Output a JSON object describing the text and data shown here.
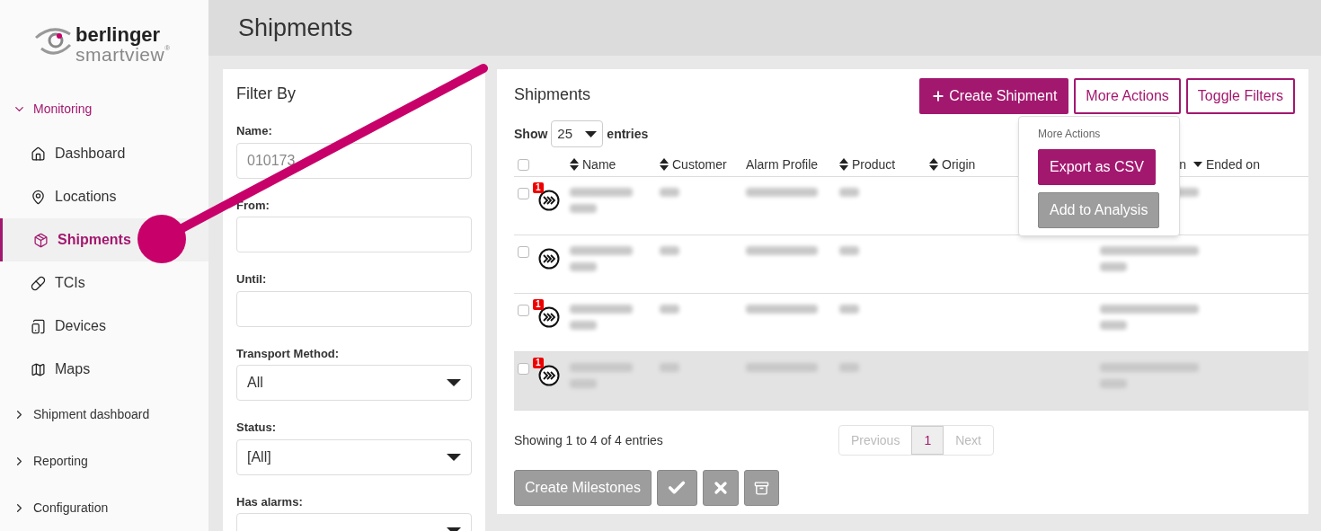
{
  "logo": {
    "line1": "berlinger",
    "line2": "smartview",
    "mark": "®"
  },
  "sidebar": {
    "groups": [
      {
        "label": "Monitoring",
        "expanded": true,
        "children": [
          {
            "label": "Dashboard",
            "kind": "home",
            "selected": false
          },
          {
            "label": "Locations",
            "kind": "pin",
            "selected": false
          },
          {
            "label": "Shipments",
            "kind": "package",
            "selected": true
          },
          {
            "label": "TCIs",
            "kind": "pill",
            "selected": false
          },
          {
            "label": "Devices",
            "kind": "device",
            "selected": false
          },
          {
            "label": "Maps",
            "kind": "map",
            "selected": false
          }
        ]
      },
      {
        "label": "Shipment dashboard",
        "expanded": false
      },
      {
        "label": "Reporting",
        "expanded": false
      },
      {
        "label": "Configuration",
        "expanded": false
      }
    ]
  },
  "page_title": "Shipments",
  "filter": {
    "title": "Filter By",
    "fields": [
      {
        "kind": "text",
        "label": "Name:",
        "placeholder": "010173"
      },
      {
        "kind": "text",
        "label": "From:"
      },
      {
        "kind": "text",
        "label": "Until:"
      },
      {
        "kind": "select",
        "label": "Transport Method:",
        "value": "All"
      },
      {
        "kind": "select",
        "label": "Status:",
        "value": "[All]"
      },
      {
        "kind": "select",
        "label": "Has alarms:"
      }
    ]
  },
  "shipments": {
    "title": "Shipments",
    "buttons": [
      {
        "kind": "primary",
        "label": "Create Shipment"
      },
      {
        "kind": "outline",
        "label": "More Actions"
      },
      {
        "kind": "outline",
        "label": "Toggle Filters"
      }
    ],
    "menu": {
      "title": "More Actions",
      "items": [
        {
          "label": "Export as CSV",
          "disabled": false
        },
        {
          "label": "Add to Analysis",
          "disabled": true
        }
      ]
    },
    "show_label": "Show",
    "page_size": "25",
    "entries_label": "entries",
    "select_all_checked": false,
    "columns": [
      {
        "label": "Name",
        "kind": "sortable"
      },
      {
        "label": "Customer",
        "kind": "sortable"
      },
      {
        "label": "Alarm Profile",
        "kind": "plain"
      },
      {
        "label": "Product",
        "kind": "sortable"
      },
      {
        "label": "Origin",
        "kind": "sortable"
      },
      {
        "label": "n",
        "kind": "plain"
      },
      {
        "label": "Ended on",
        "kind": "sorted"
      }
    ],
    "rows": [
      {
        "alarms": "1",
        "checked": false,
        "highlighted": false
      },
      {
        "checked": false,
        "highlighted": false
      },
      {
        "alarms": "1",
        "checked": false,
        "highlighted": false
      },
      {
        "alarms": "1",
        "checked": false,
        "highlighted": true
      }
    ],
    "info": "Showing 1 to 4 of 4 entries",
    "pagination": [
      {
        "label": "Previous",
        "disabled": true,
        "selected": false
      },
      {
        "label": "1",
        "disabled": false,
        "selected": true
      },
      {
        "label": "Next",
        "disabled": true,
        "selected": false
      }
    ],
    "bottom_buttons": [
      {
        "kind": "text",
        "label": "Create Milestones"
      },
      {
        "kind": "check"
      },
      {
        "kind": "cross"
      },
      {
        "kind": "archive"
      }
    ]
  }
}
